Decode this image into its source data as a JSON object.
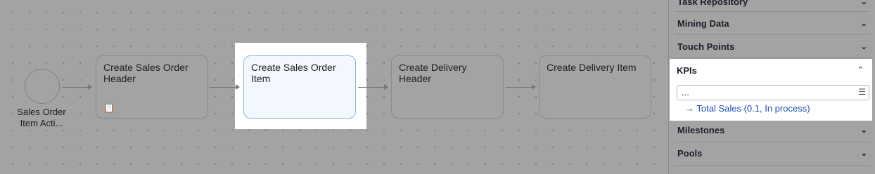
{
  "flow": {
    "start_event_label": "Sales Order Item Acti...",
    "tasks": [
      {
        "label": "Create Sales Order Header",
        "icon": "clipboard-icon"
      },
      {
        "label": "Create Sales Order Item"
      },
      {
        "label": "Create Delivery Header"
      },
      {
        "label": "Create Delivery Item"
      }
    ]
  },
  "panel": {
    "sections": [
      {
        "label": "Task Repository"
      },
      {
        "label": "Mining Data"
      },
      {
        "label": "Touch Points"
      },
      {
        "label": "KPIs"
      },
      {
        "label": "Milestones"
      },
      {
        "label": "Pools"
      }
    ],
    "kpis": {
      "search_value": "...",
      "items": [
        {
          "label": "Total Sales (0.1, In process)"
        }
      ]
    }
  },
  "colors": {
    "highlight": "#ffffff",
    "selected_task": "#f3f8fe",
    "link": "#1f4fb5"
  }
}
